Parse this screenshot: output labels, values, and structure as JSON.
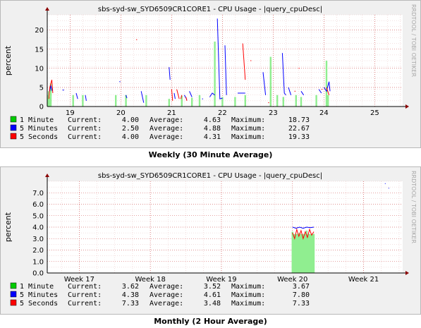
{
  "chart_data": [
    {
      "type": "line",
      "title": "sbs-syd-sw_SYD6509CR1CORE1 - CPU Usage - |query_cpuDesc|",
      "ylabel": "percent",
      "watermark": "RRDTOOL / TOBI OETIKER",
      "caption": "Weekly (30 Minute Average)",
      "x_ticks": [
        "19",
        "20",
        "21",
        "22",
        "23",
        "24",
        "25"
      ],
      "y_ticks": [
        "0",
        "5",
        "10",
        "15",
        "20"
      ],
      "xlim": [
        18.55,
        25.55
      ],
      "ylim": [
        0,
        24
      ],
      "grid": true,
      "colors": {
        "one_minute": "#00cc00",
        "five_minutes": "#0000ff",
        "five_seconds": "#ff0000",
        "area": "#90ee90"
      },
      "series": [
        {
          "name": "1 Minute",
          "kind": "area",
          "points": [
            [
              18.56,
              3
            ],
            [
              18.58,
              4
            ],
            [
              18.62,
              6
            ],
            [
              18.6,
              2.5
            ],
            [
              19.06,
              3
            ],
            [
              19.25,
              3
            ],
            [
              19.9,
              3
            ],
            [
              20.1,
              3
            ],
            [
              20.5,
              3
            ],
            [
              20.95,
              2
            ],
            [
              21.2,
              2.8
            ],
            [
              21.4,
              2.3
            ],
            [
              21.55,
              3
            ],
            [
              21.85,
              17
            ],
            [
              22.0,
              2.5
            ],
            [
              22.25,
              2.5
            ],
            [
              22.45,
              3
            ],
            [
              22.95,
              13
            ],
            [
              23.08,
              3
            ],
            [
              23.2,
              2.5
            ],
            [
              23.45,
              3
            ],
            [
              23.55,
              2.5
            ],
            [
              23.85,
              3
            ],
            [
              24.05,
              12
            ],
            [
              24.08,
              3
            ]
          ]
        },
        {
          "name": "5 Minutes",
          "kind": "segments",
          "segments": [
            [
              [
                18.6,
                4
              ],
              [
                18.62,
                5.5
              ],
              [
                18.65,
                4
              ]
            ],
            [
              [
                18.85,
                4.3
              ],
              [
                18.88,
                4.3
              ]
            ],
            [
              [
                19.12,
                3.5
              ],
              [
                19.15,
                2
              ]
            ],
            [
              [
                19.3,
                3
              ],
              [
                19.32,
                1.5
              ]
            ],
            [
              [
                19.97,
                6.5
              ],
              [
                19.99,
                6.5
              ]
            ],
            [
              [
                20.1,
                3
              ],
              [
                20.12,
                2.2
              ]
            ],
            [
              [
                20.4,
                4
              ],
              [
                20.45,
                1
              ]
            ],
            [
              [
                20.95,
                10.3
              ],
              [
                20.97,
                7
              ]
            ],
            [
              [
                21.05,
                3.5
              ],
              [
                21.07,
                2
              ]
            ],
            [
              [
                21.25,
                3
              ],
              [
                21.3,
                1.8
              ]
            ],
            [
              [
                21.35,
                4
              ],
              [
                21.4,
                2.5
              ]
            ],
            [
              [
                21.6,
                2
              ],
              [
                21.62,
                2
              ]
            ],
            [
              [
                21.75,
                2.5
              ],
              [
                21.8,
                3.5
              ],
              [
                21.85,
                3
              ]
            ],
            [
              [
                21.9,
                23
              ],
              [
                21.95,
                2
              ],
              [
                22.0,
                2.2
              ]
            ],
            [
              [
                22.05,
                16
              ],
              [
                22.08,
                3
              ]
            ],
            [
              [
                22.3,
                3.5
              ],
              [
                22.45,
                3.5
              ]
            ],
            [
              [
                22.8,
                9
              ],
              [
                22.85,
                3
              ]
            ],
            [
              [
                23.18,
                14
              ],
              [
                23.22,
                3.5
              ],
              [
                23.25,
                3
              ]
            ],
            [
              [
                23.3,
                5
              ],
              [
                23.35,
                3
              ]
            ],
            [
              [
                23.55,
                4
              ],
              [
                23.6,
                3
              ]
            ],
            [
              [
                23.9,
                4.5
              ],
              [
                23.95,
                3.5
              ]
            ],
            [
              [
                24.0,
                5
              ],
              [
                24.05,
                4
              ],
              [
                24.1,
                6.5
              ],
              [
                24.12,
                4
              ]
            ]
          ]
        },
        {
          "name": "5 Seconds",
          "kind": "segments",
          "segments": [
            [
              [
                18.58,
                2
              ],
              [
                18.6,
                5
              ],
              [
                18.62,
                6
              ],
              [
                18.64,
                7
              ],
              [
                18.66,
                3.5
              ]
            ],
            [
              [
                20.3,
                17.5
              ],
              [
                20.32,
                17.5
              ]
            ],
            [
              [
                21.0,
                4.5
              ],
              [
                21.02,
                1.5
              ]
            ],
            [
              [
                21.1,
                4.5
              ],
              [
                21.15,
                2
              ]
            ],
            [
              [
                21.18,
                2
              ],
              [
                21.2,
                3
              ]
            ],
            [
              [
                21.28,
                2.5
              ],
              [
                21.3,
                1.5
              ]
            ],
            [
              [
                22.4,
                16.5
              ],
              [
                22.45,
                7
              ]
            ],
            [
              [
                22.55,
                12
              ],
              [
                22.57,
                12
              ]
            ],
            [
              [
                22.9,
                1
              ],
              [
                22.92,
                1
              ]
            ],
            [
              [
                23.42,
                4
              ],
              [
                23.44,
                4
              ]
            ],
            [
              [
                23.5,
                10
              ],
              [
                23.52,
                10
              ]
            ],
            [
              [
                23.95,
                4.5
              ],
              [
                23.97,
                4.5
              ]
            ],
            [
              [
                24.05,
                5
              ],
              [
                24.1,
                3
              ]
            ]
          ]
        }
      ],
      "legend": [
        {
          "label": "1 Minute",
          "current": "4.00",
          "average": "4.63",
          "maximum": "18.73",
          "color": "#00cc00"
        },
        {
          "label": "5 Minutes",
          "current": "2.50",
          "average": "4.88",
          "maximum": "22.67",
          "color": "#0000ff"
        },
        {
          "label": "5 Seconds",
          "current": "4.00",
          "average": "4.31",
          "maximum": "19.33",
          "color": "#ff0000"
        }
      ]
    },
    {
      "type": "line",
      "title": "sbs-syd-sw_SYD6509CR1CORE1 - CPU Usage - |query_cpuDesc|",
      "ylabel": "percent",
      "watermark": "RRDTOOL / TOBI OETIKER",
      "caption": "Monthly (2 Hour Average)",
      "x_ticks": [
        "Week 17",
        "Week 18",
        "Week 19",
        "Week 20",
        "Week 21"
      ],
      "y_ticks": [
        "0.0",
        "1.0",
        "2.0",
        "3.0",
        "4.0",
        "5.0",
        "6.0",
        "7.0"
      ],
      "xlim": [
        16.55,
        21.55
      ],
      "ylim": [
        0,
        8
      ],
      "grid": true,
      "colors": {
        "one_minute": "#00cc00",
        "five_minutes": "#0000ff",
        "five_seconds": "#ff0000",
        "area": "#90ee90"
      },
      "series": [
        {
          "name": "1 Minute",
          "kind": "area",
          "points": [
            [
              20.0,
              3.6
            ],
            [
              20.1,
              3.5
            ],
            [
              20.2,
              3.7
            ],
            [
              20.3,
              3.4
            ]
          ]
        },
        {
          "name": "5 Minutes",
          "kind": "segments",
          "segments": [
            [
              [
                20.0,
                4.0
              ],
              [
                20.05,
                3.9
              ],
              [
                20.1,
                4.0
              ],
              [
                20.15,
                3.9
              ],
              [
                20.2,
                4.0
              ],
              [
                20.25,
                3.95
              ],
              [
                20.3,
                4.0
              ]
            ],
            [
              [
                21.3,
                7.8
              ],
              [
                21.31,
                7.8
              ]
            ],
            [
              [
                21.35,
                7.4
              ],
              [
                21.36,
                7.4
              ]
            ]
          ]
        },
        {
          "name": "5 Seconds",
          "kind": "segments",
          "segments": [
            [
              [
                20.0,
                3.5
              ],
              [
                20.03,
                3.0
              ],
              [
                20.06,
                3.8
              ],
              [
                20.09,
                3.2
              ],
              [
                20.12,
                3.7
              ],
              [
                20.15,
                3.0
              ],
              [
                20.18,
                3.6
              ],
              [
                20.21,
                3.1
              ],
              [
                20.24,
                3.8
              ],
              [
                20.27,
                3.3
              ],
              [
                20.3,
                3.6
              ]
            ]
          ]
        }
      ],
      "legend": [
        {
          "label": "1 Minute",
          "current": "3.62",
          "average": "3.52",
          "maximum": "3.67",
          "color": "#00cc00"
        },
        {
          "label": "5 Minutes",
          "current": "4.38",
          "average": "4.61",
          "maximum": "7.80",
          "color": "#0000ff"
        },
        {
          "label": "5 Seconds",
          "current": "7.33",
          "average": "3.48",
          "maximum": "7.33",
          "color": "#ff0000"
        }
      ]
    }
  ],
  "labels": {
    "current": "Current:",
    "average": "Average:",
    "maximum": "Maximum:"
  }
}
